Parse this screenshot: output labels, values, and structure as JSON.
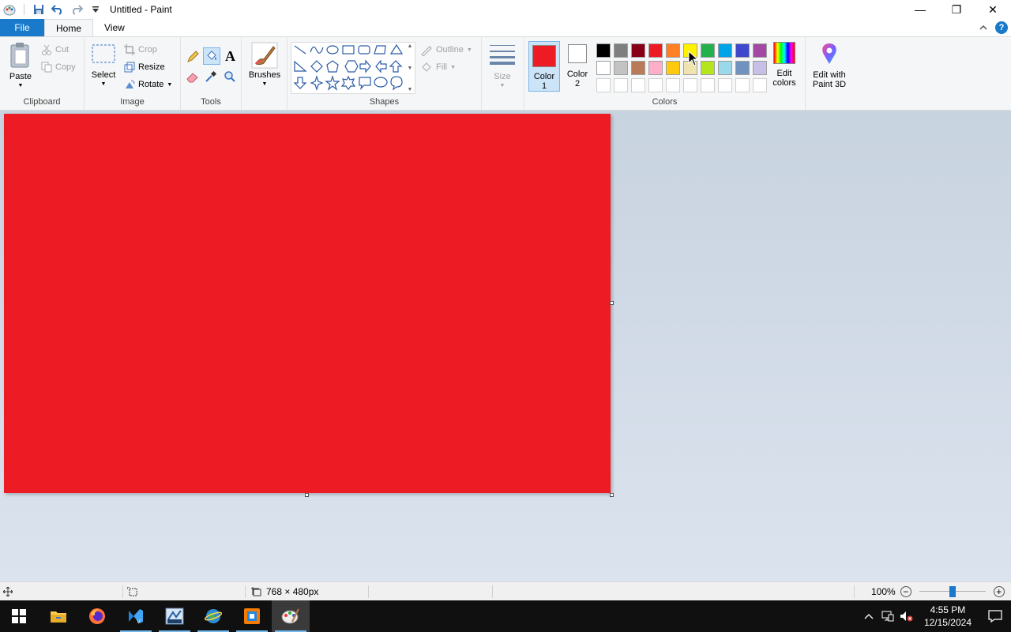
{
  "window": {
    "title": "Untitled - Paint",
    "controls": {
      "minimize": "—",
      "restore": "❐",
      "close": "✕"
    }
  },
  "ribbon_tabs": [
    {
      "label": "File"
    },
    {
      "label": "Home"
    },
    {
      "label": "View"
    }
  ],
  "clipboard": {
    "group_label": "Clipboard",
    "paste_label": "Paste",
    "cut_label": "Cut",
    "copy_label": "Copy"
  },
  "image": {
    "group_label": "Image",
    "select_label": "Select",
    "crop_label": "Crop",
    "resize_label": "Resize",
    "rotate_label": "Rotate"
  },
  "tools": {
    "group_label": "Tools",
    "text_tool": "A"
  },
  "brushes": {
    "label": "Brushes"
  },
  "shapes": {
    "group_label": "Shapes",
    "outline_label": "Outline",
    "fill_label": "Fill"
  },
  "size": {
    "label": "Size"
  },
  "colors": {
    "group_label": "Colors",
    "color1": {
      "line1": "Color",
      "line2": "1",
      "value": "#ed1c24"
    },
    "color2": {
      "line1": "Color",
      "line2": "2",
      "value": "#ffffff"
    },
    "edit_colors": {
      "line1": "Edit",
      "line2": "colors"
    },
    "palette_row1": [
      "#000000",
      "#7f7f7f",
      "#880015",
      "#ed1c24",
      "#ff7f27",
      "#fff200",
      "#22b14c",
      "#00a2e8",
      "#3f48cc",
      "#a349a4"
    ],
    "palette_row2": [
      "#ffffff",
      "#c3c3c3",
      "#b97a57",
      "#ffaec9",
      "#ffc90e",
      "#efe4b0",
      "#b5e61d",
      "#99d9ea",
      "#7092be",
      "#c8bfe7"
    ],
    "palette_row3": [
      "#ffffff",
      "#ffffff",
      "#ffffff",
      "#ffffff",
      "#ffffff",
      "#ffffff",
      "#ffffff",
      "#ffffff",
      "#ffffff",
      "#ffffff"
    ]
  },
  "paint3d": {
    "line1": "Edit with",
    "line2": "Paint 3D"
  },
  "canvas": {
    "fill_color": "#ed1c24"
  },
  "statusbar": {
    "image_size": "768 × 480px",
    "zoom": "100%",
    "zoom_percent": 100
  },
  "taskbar": {
    "time": "4:55 PM",
    "date": "12/15/2024"
  }
}
